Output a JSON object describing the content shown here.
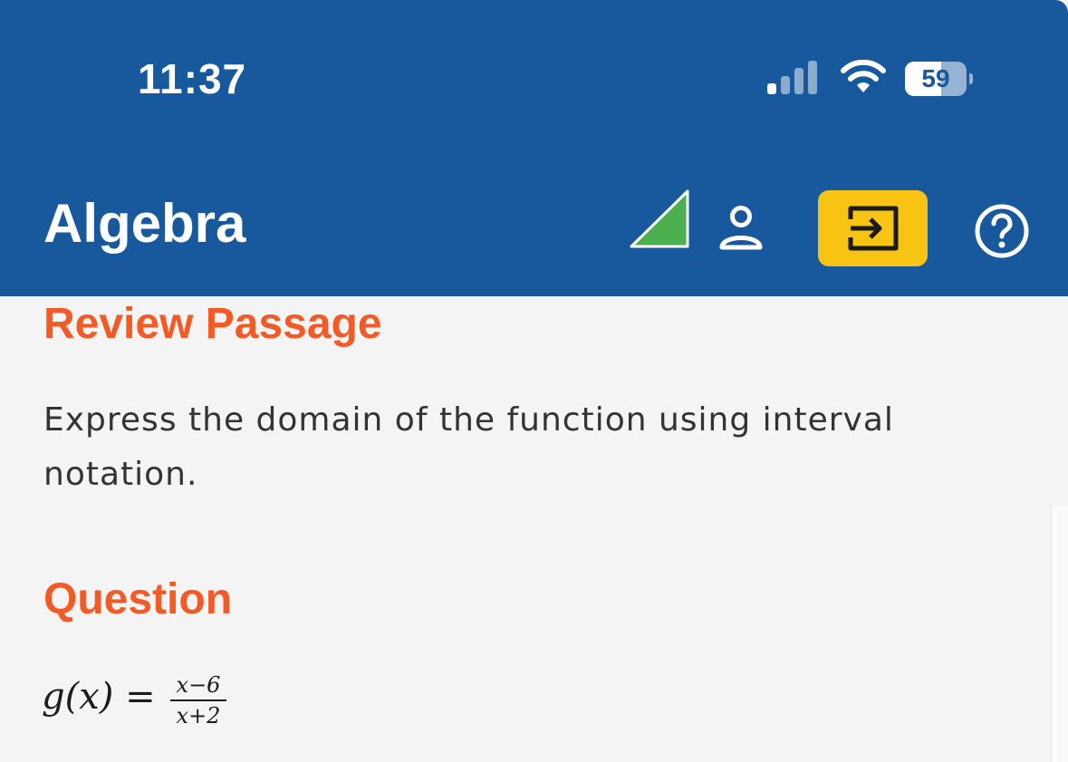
{
  "status_bar": {
    "time": "11:37",
    "battery_level": "59",
    "battery_fraction": 0.59
  },
  "header": {
    "title": "Algebra",
    "icons": [
      "progress-triangle-icon",
      "user-icon",
      "exit-icon",
      "help-icon"
    ],
    "colors": {
      "bar": "#18589d",
      "progress": "#4caf50",
      "exit_button": "#f8c413"
    }
  },
  "content": {
    "review_heading": "Review Passage",
    "passage": "Express the domain of the function using interval notation.",
    "question_heading": "Question",
    "equation": {
      "lhs": "g(x) =",
      "numerator": "x−6",
      "denominator": "x+2"
    },
    "heading_color": "#f25a26"
  }
}
